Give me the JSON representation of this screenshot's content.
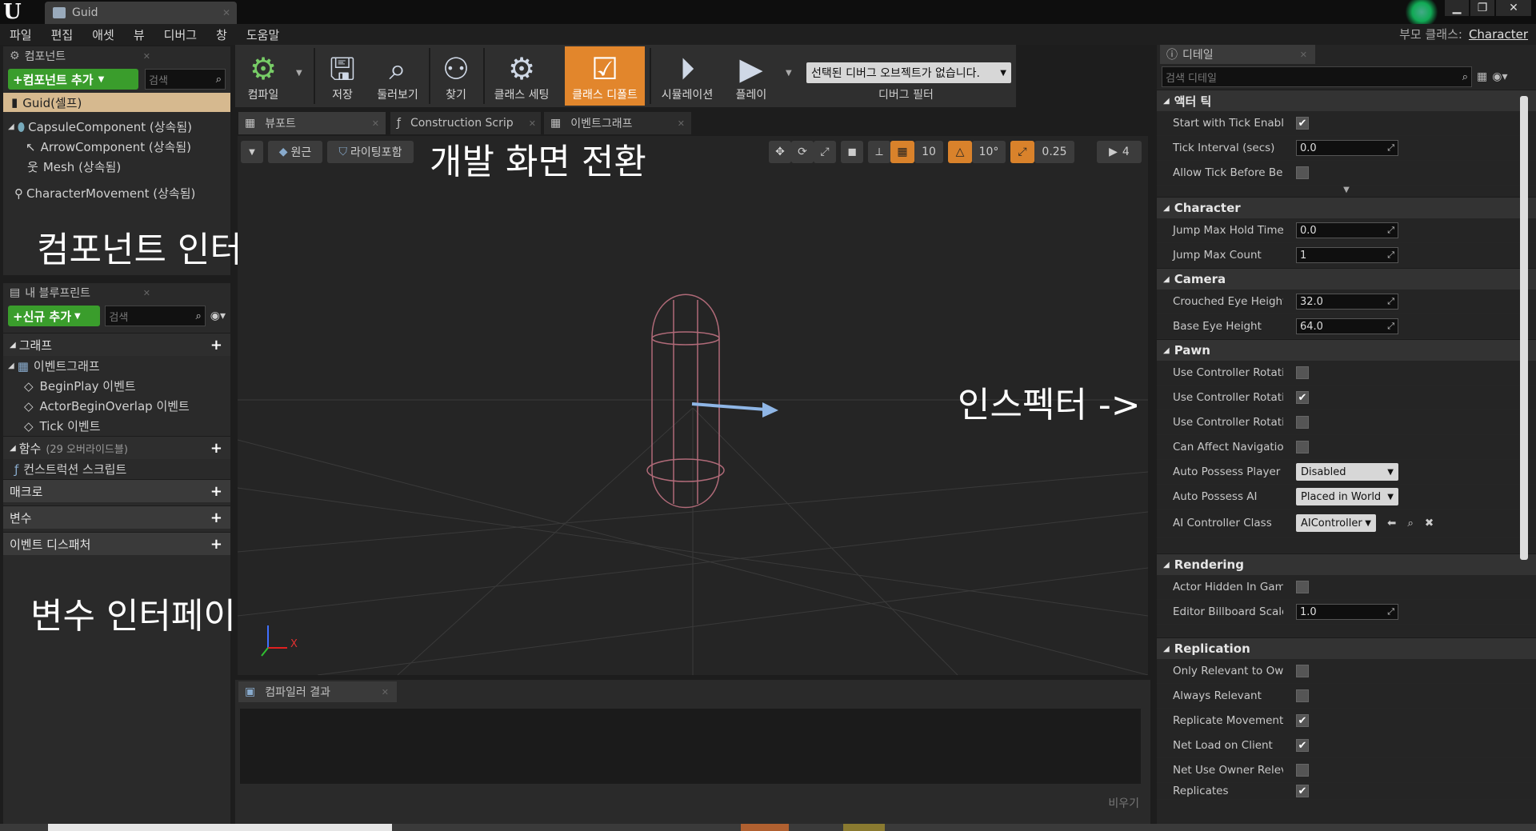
{
  "window": {
    "tab_title": "Guid",
    "parent_class_label": "부모 클래스:",
    "parent_class_value": "Character"
  },
  "menu": [
    "파일",
    "편집",
    "애셋",
    "뷰",
    "디버그",
    "창",
    "도움말"
  ],
  "components_panel": {
    "tab_label": "컴포넌트",
    "add_button": "+컴포넌트 추가",
    "search_placeholder": "검색",
    "items": [
      "Guid(셀프)",
      "CapsuleComponent (상속됨)",
      "ArrowComponent (상속됨)",
      "Mesh (상속됨)",
      "CharacterMovement (상속됨)"
    ],
    "overlay": "컴포넌트 인터페이스"
  },
  "blueprint_panel": {
    "tab_label": "내 블루프린트",
    "add_button": "+신규 추가",
    "search_placeholder": "검색",
    "graph_section": "그래프",
    "event_graph": "이벤트그래프",
    "events": [
      "BeginPlay 이벤트",
      "ActorBeginOverlap 이벤트",
      "Tick 이벤트"
    ],
    "functions_section": "함수",
    "functions_count": "(29 오버라이드블)",
    "construction_script": "컨스트럭션 스크립트",
    "macro_section": "매크로",
    "variables_section": "변수",
    "dispatchers_section": "이벤트 디스패처",
    "overlay": "변수 인터페이스"
  },
  "toolbar": {
    "compile": "컴파일",
    "save": "저장",
    "browse": "둘러보기",
    "find": "찾기",
    "class_settings": "클래스 세팅",
    "class_defaults": "클래스 디폴트",
    "simulation": "시뮬레이션",
    "play": "플레이",
    "debug_select": "선택된 디버그 오브젝트가 없습니다.",
    "debug_filter": "디버그 필터"
  },
  "editor_tabs": [
    "뷰포트",
    "Construction Scrip",
    "이벤트그래프"
  ],
  "viewport": {
    "perspective_label": "원근",
    "lit_label": "라이팅포함",
    "grid_snap": "10",
    "rot_snap": "10°",
    "scale_snap": "0.25",
    "camera_speed": "4",
    "overlay_title": "개발 화면 전환",
    "overlay_inspector": "인스펙터 ->",
    "axis_x": "X"
  },
  "compiler": {
    "tab_label": "컴파일러 결과",
    "clear_label": "비우기"
  },
  "details": {
    "tab_label": "디테일",
    "search_placeholder": "검색 디테일",
    "categories": {
      "tick": "액터 틱",
      "character": "Character",
      "camera": "Camera",
      "pawn": "Pawn",
      "rendering": "Rendering",
      "replication": "Replication"
    },
    "tick": {
      "start_with_tick": "Start with Tick Enabl",
      "tick_interval": "Tick Interval (secs)",
      "tick_interval_val": "0.0",
      "allow_tick": "Allow Tick Before Be"
    },
    "character": {
      "jump_hold": "Jump Max Hold Time",
      "jump_hold_val": "0.0",
      "jump_count": "Jump Max Count",
      "jump_count_val": "1"
    },
    "camera": {
      "crouched": "Crouched Eye Height",
      "crouched_val": "32.0",
      "base": "Base Eye Height",
      "base_val": "64.0"
    },
    "pawn": {
      "ucr1": "Use Controller Rotati",
      "ucr2": "Use Controller Rotati",
      "ucr3": "Use Controller Rotati",
      "can_affect": "Can Affect Navigatio",
      "auto_player": "Auto Possess Player",
      "auto_player_val": "Disabled",
      "auto_ai": "Auto Possess AI",
      "auto_ai_val": "Placed in World",
      "ai_class": "AI Controller Class",
      "ai_class_val": "AIController"
    },
    "rendering": {
      "hidden": "Actor Hidden In Game",
      "billboard": "Editor Billboard Scale",
      "billboard_val": "1.0"
    },
    "replication": {
      "only_relevant": "Only Relevant to Owr",
      "always_relevant": "Always Relevant",
      "replicate_movement": "Replicate Movement",
      "net_load": "Net Load on Client",
      "net_owner": "Net Use Owner Relev",
      "replicates": "Replicates"
    }
  }
}
